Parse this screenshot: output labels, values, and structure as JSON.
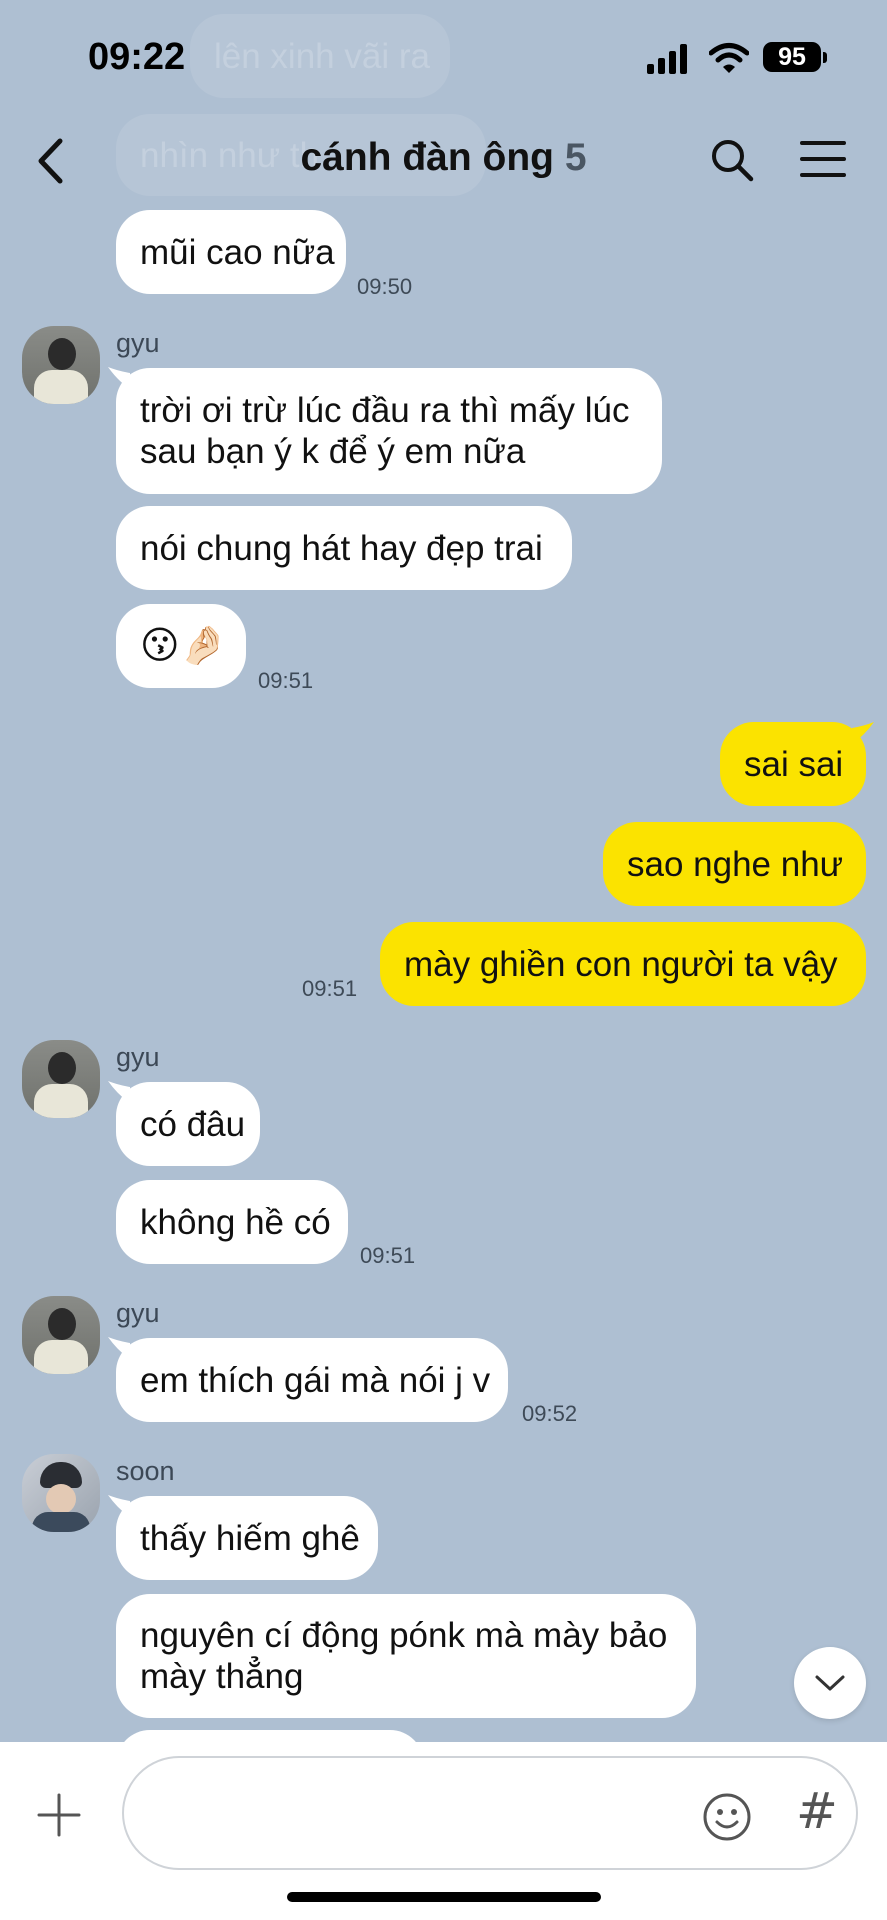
{
  "status_bar": {
    "time": "09:22",
    "battery": "95"
  },
  "header": {
    "title": "cánh đàn ông",
    "member_count": "5"
  },
  "ghost_messages": [
    "lên xinh vãi ra",
    "nhìn như th"
  ],
  "messages": {
    "m1": {
      "text": "mũi cao nữa",
      "time": "09:50"
    },
    "g1": {
      "sender": "gyu",
      "lines": [
        "trời ơi trừ lúc đầu ra thì mấy lúc",
        "sau bạn ý k để ý em nữa"
      ]
    },
    "m2": {
      "text": "nói chung hát hay đẹp trai"
    },
    "m3": {
      "text": "😗🤌🏻",
      "time": "09:51"
    },
    "me1": {
      "text": "sai sai"
    },
    "me2": {
      "text": "sao nghe như"
    },
    "me3": {
      "text": "mày ghiền con người ta vậy",
      "time": "09:51"
    },
    "g2": {
      "sender": "gyu",
      "text": "có đâu"
    },
    "m4": {
      "text": "không hề có",
      "time": "09:51"
    },
    "g3": {
      "sender": "gyu",
      "text": "em thích gái mà nói j v",
      "time": "09:52"
    },
    "s1": {
      "sender": "soon",
      "text": "thấy hiếm ghê"
    },
    "s2": {
      "lines": [
        "nguyên cí động pónk mà mày bảo",
        "mày thẳng"
      ]
    }
  },
  "input_bar": {
    "placeholder": "",
    "hash_label": "#"
  },
  "icons": [
    "back-chevron-icon",
    "search-icon",
    "menu-icon",
    "plus-icon",
    "emoji-icon",
    "hash-icon",
    "scroll-down-icon",
    "signal-icon",
    "wifi-icon",
    "battery-icon"
  ]
}
